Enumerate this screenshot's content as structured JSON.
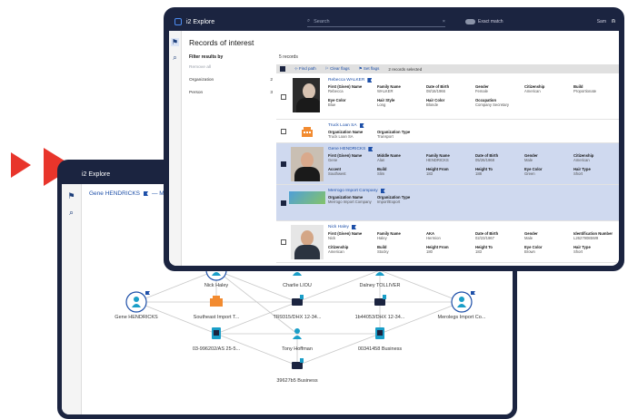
{
  "back_window": {
    "app_title": "i2 Explore",
    "chart_header": "Gene HENDRICKS",
    "chart_header_tail": "— Me",
    "nodes": [
      {
        "id": "gene",
        "label": "Gene HENDRICKS",
        "kind": "person-flag"
      },
      {
        "id": "nick",
        "label": "Nick Haley",
        "kind": "person-flag"
      },
      {
        "id": "charlie",
        "label": "Charlie LIOU",
        "kind": "person"
      },
      {
        "id": "dalney",
        "label": "Dalney TOLLIVER",
        "kind": "person"
      },
      {
        "id": "southeast",
        "label": "Southeast Import T...",
        "kind": "org"
      },
      {
        "id": "phone1",
        "label": "TR9315/DHX 12-34...",
        "kind": "phone"
      },
      {
        "id": "phone2",
        "label": "1b44053/DHX 12-34...",
        "kind": "phone"
      },
      {
        "id": "merlogo",
        "label": "Merolegs Import Co...",
        "kind": "person-flag"
      },
      {
        "id": "doc1",
        "label": "03-996202/AS 25-5...",
        "kind": "doc"
      },
      {
        "id": "tony",
        "label": "Tony Hoffman",
        "kind": "person"
      },
      {
        "id": "biz1",
        "label": "00341458 Business",
        "kind": "doc"
      },
      {
        "id": "biz2",
        "label": "39627b5 Business",
        "kind": "phone"
      }
    ]
  },
  "front_window": {
    "app_title": "i2 Explore",
    "search_placeholder": "Search",
    "exact_match_label": "Exact match",
    "user_label": "Sam",
    "page_title": "Records of interest",
    "filter": {
      "heading": "Filter results by",
      "items": [
        {
          "label": "Remove all",
          "count": "",
          "muted": true
        },
        {
          "label": "Organization",
          "count": "2",
          "muted": false
        },
        {
          "label": "Person",
          "count": "3",
          "muted": false
        }
      ]
    },
    "record_count": "5 records",
    "toolbar": {
      "find_path": "Find path",
      "clear_flags": "Clear flags",
      "set_flags": "Set flags",
      "selected": "2 records selected"
    },
    "records": [
      {
        "type": "person",
        "selected": false,
        "title": "Rebecca WALKER",
        "thumb": "woman",
        "fields": [
          {
            "k": "First (Given) Name",
            "v": "Rebecca"
          },
          {
            "k": "Family Name",
            "v": "WALKER"
          },
          {
            "k": "Date of Birth",
            "v": "08/16/1966"
          },
          {
            "k": "Gender",
            "v": "Female"
          },
          {
            "k": "Citizenship",
            "v": "American"
          },
          {
            "k": "Build",
            "v": "Proportionate"
          },
          {
            "k": "Eye Color",
            "v": "Blue"
          },
          {
            "k": "Hair Style",
            "v": "Long"
          },
          {
            "k": "Hair Color",
            "v": "Blonde"
          },
          {
            "k": "Occupation",
            "v": "Company Secretary"
          },
          {
            "k": "",
            "v": ""
          },
          {
            "k": "",
            "v": ""
          }
        ]
      },
      {
        "type": "org",
        "selected": false,
        "title": "Truck Loan SA",
        "thumb": "building",
        "fields": [
          {
            "k": "Organization Name",
            "v": "Truck Loan SA"
          },
          {
            "k": "Organization Type",
            "v": "Transport"
          }
        ]
      },
      {
        "type": "person",
        "selected": true,
        "title": "Gene HENDRICKS",
        "thumb": "man",
        "fields": [
          {
            "k": "First (Given) Name",
            "v": "Gene"
          },
          {
            "k": "Middle Name",
            "v": "Alan"
          },
          {
            "k": "Family Name",
            "v": "HENDRICKS"
          },
          {
            "k": "Date of Birth",
            "v": "05/26/1968"
          },
          {
            "k": "Gender",
            "v": "Male"
          },
          {
            "k": "Citizenship",
            "v": "American"
          },
          {
            "k": "Accent",
            "v": "Southwest"
          },
          {
            "k": "Build",
            "v": "Slim"
          },
          {
            "k": "Height From",
            "v": "183"
          },
          {
            "k": "Height To",
            "v": "188"
          },
          {
            "k": "Eye Color",
            "v": "Green"
          },
          {
            "k": "Hair Type",
            "v": "Short"
          }
        ]
      },
      {
        "type": "org",
        "selected": true,
        "title": "Merrogo Import Company",
        "thumb": "logo",
        "fields": [
          {
            "k": "Organization Name",
            "v": "Merrogo Import Company"
          },
          {
            "k": "Organization Type",
            "v": "Import/Export"
          }
        ]
      },
      {
        "type": "person",
        "selected": false,
        "title": "Nick Haley",
        "thumb": "man2",
        "fields": [
          {
            "k": "First (Given) Name",
            "v": "Nick"
          },
          {
            "k": "Family Name",
            "v": "Haley"
          },
          {
            "k": "AKA",
            "v": "Hermion"
          },
          {
            "k": "Date of Birth",
            "v": "02/23/1967"
          },
          {
            "k": "Gender",
            "v": "Male"
          },
          {
            "k": "Identification Number",
            "v": "L26279085W9"
          },
          {
            "k": "Citizenship",
            "v": "American"
          },
          {
            "k": "Build",
            "v": "Stocky"
          },
          {
            "k": "Height From",
            "v": "180"
          },
          {
            "k": "Height To",
            "v": "183"
          },
          {
            "k": "Eye Color",
            "v": "Brown"
          },
          {
            "k": "Hair Type",
            "v": "Short"
          }
        ]
      }
    ]
  },
  "colors": {
    "window_frame": "#1b2440",
    "accent_blue": "#1d4fa8",
    "selected_row": "#cfd9ef",
    "play_arrow": "#e8352b",
    "node_cyan": "#1a9ec8"
  }
}
